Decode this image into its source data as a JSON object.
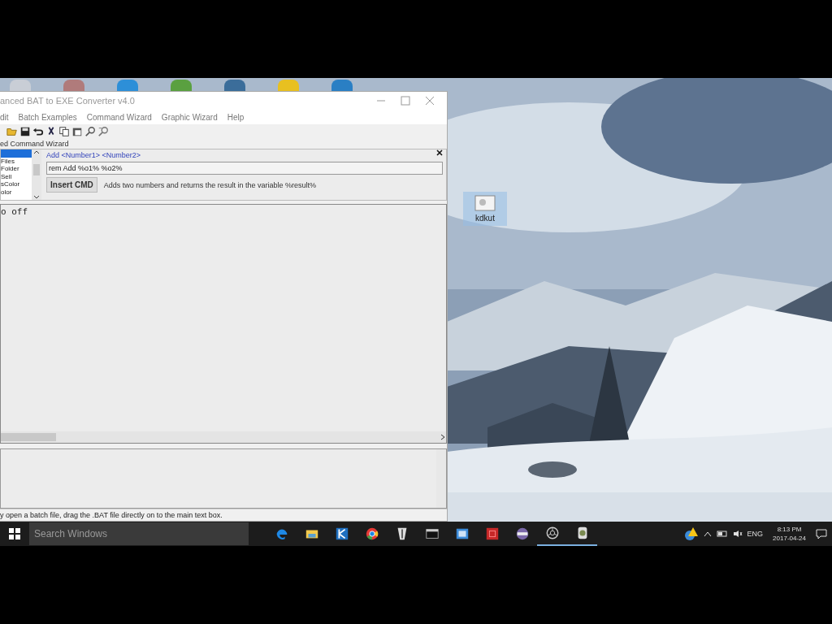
{
  "window": {
    "title": "anced BAT to EXE Converter v4.0"
  },
  "menu": [
    "dit",
    "Batch Examples",
    "Command Wizard",
    "Graphic Wizard",
    "Help"
  ],
  "toolbar": [
    {
      "kind": "open"
    },
    {
      "kind": "save"
    },
    {
      "kind": "undo"
    },
    {
      "kind": "cut"
    },
    {
      "kind": "copy"
    },
    {
      "kind": "paste"
    },
    {
      "kind": "find"
    },
    {
      "kind": "replace"
    }
  ],
  "wizard": {
    "title": "ed Command Wizard",
    "list": [
      {
        "selected": true
      },
      {
        "label": "Files",
        "selected": false
      },
      {
        "label": "Folder",
        "selected": false
      },
      {
        "label": "Sell",
        "selected": false
      },
      {
        "label": "sColor",
        "selected": false
      },
      {
        "label": "olor",
        "selected": false
      }
    ],
    "syntax": "Add <Number1> <Number2>",
    "command": "rem Add %o1% %o2%",
    "button": "Insert CMD",
    "description": "Adds two numbers and returns the result in the variable %result%"
  },
  "editor": {
    "text": "o off"
  },
  "status_bar": "y open a batch file, drag the .BAT file directly on to the main text box.",
  "desktop_shortcut": {
    "label": "kdkut",
    "selected": true
  },
  "taskbar": {
    "search": {
      "placeholder": "Search Windows"
    },
    "apps": [
      {
        "kind": "edge",
        "running": false
      },
      {
        "kind": "folder",
        "running": false
      },
      {
        "kind": "tile",
        "running": false
      },
      {
        "kind": "chrome",
        "running": false
      },
      {
        "kind": "pen",
        "running": false
      },
      {
        "kind": "terminal",
        "running": false
      },
      {
        "kind": "window",
        "running": false
      },
      {
        "kind": "red",
        "running": false
      },
      {
        "kind": "disc",
        "running": false
      },
      {
        "kind": "aperture",
        "running": true
      },
      {
        "kind": "gear",
        "running": true
      }
    ],
    "language": "ENG",
    "time": "8:13 PM",
    "date": "2017-04-24"
  }
}
